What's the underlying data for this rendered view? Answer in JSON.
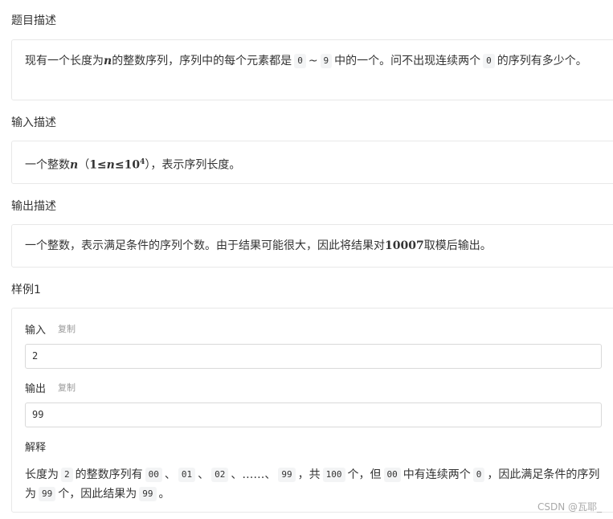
{
  "sections": {
    "description": {
      "heading": "题目描述",
      "p1": "现有一个长度为",
      "var_n": "n",
      "p2": "的整数序列，序列中的每个元素都是",
      "c0": "0",
      "tilde": "~",
      "c9": "9",
      "p3": "中的一个。问不出现连续两个",
      "c0b": "0",
      "p4": "的序列有多少个。"
    },
    "input": {
      "heading": "输入描述",
      "p1": "一个整数",
      "var_n": "n",
      "paren_open": "（",
      "range_pre": "1≤",
      "range_var": "n",
      "range_post": "≤10",
      "range_exp": "4",
      "paren_close": "）",
      "p2": "，表示序列长度。"
    },
    "output": {
      "heading": "输出描述",
      "p1": "一个整数，表示满足条件的序列个数。由于结果可能很大，因此将结果对",
      "mod": "10007",
      "p2": "取模后输出。"
    },
    "sample": {
      "heading": "样例1",
      "input_label": "输入",
      "input_copy": "复制",
      "input_value": "2",
      "output_label": "输出",
      "output_copy": "复制",
      "output_value": "99",
      "explain_label": "解释",
      "e1": "长度为",
      "c2": "2",
      "e2": "的整数序列有",
      "c00": "00",
      "sep1": "、",
      "c01": "01",
      "sep2": "、",
      "c02": "02",
      "sep3": "、……、",
      "c99": "99",
      "e3": "，共",
      "c100": "100",
      "e4": "个，但",
      "c00b": "00",
      "e5": "中有连续两个",
      "c0": "0",
      "e6": "，因此满足条件的序列为",
      "c99b": "99",
      "e7": "个，因此结果为",
      "c99c": "99",
      "e8": "。"
    }
  },
  "watermark": "CSDN @瓦耶_"
}
